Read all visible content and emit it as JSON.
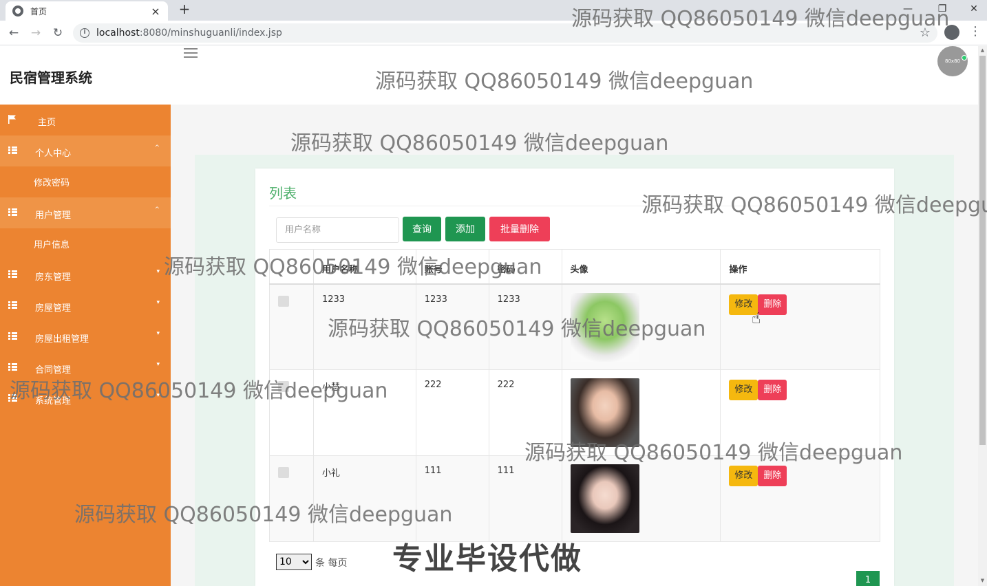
{
  "browser": {
    "tab_title": "首页",
    "tab_close": "×",
    "new_tab": "+",
    "url_host": "localhost",
    "url_rest": ":8080/minshuguanli/index.jsp",
    "win_min": "—",
    "win_max": "❐",
    "win_close": "✕"
  },
  "app": {
    "title": "民宿管理系统",
    "avatar_text": "80x80"
  },
  "sidebar": {
    "items": [
      {
        "label": "主页",
        "icon": "flag-icon"
      },
      {
        "label": "个人中心",
        "icon": "grid-icon",
        "expanded": true
      },
      {
        "label": "修改密码",
        "sub": true
      },
      {
        "label": "用户管理",
        "icon": "grid-icon",
        "expanded": true
      },
      {
        "label": "用户信息",
        "sub": true
      },
      {
        "label": "房东管理",
        "icon": "grid-icon"
      },
      {
        "label": "房屋管理",
        "icon": "grid-icon"
      },
      {
        "label": "房屋出租管理",
        "icon": "grid-icon"
      },
      {
        "label": "合同管理",
        "icon": "grid-icon"
      },
      {
        "label": "系统管理",
        "icon": "grid-icon"
      }
    ]
  },
  "main": {
    "card_title": "列表",
    "search_placeholder": "用户名称",
    "btn_query": "查询",
    "btn_add": "添加",
    "btn_batch_delete": "批量删除",
    "table": {
      "headers": [
        "",
        "用户名称",
        "账号",
        "密码",
        "头像",
        "操作"
      ],
      "rows": [
        {
          "name": "1233",
          "account": "1233",
          "password": "1233"
        },
        {
          "name": "小慧",
          "account": "222",
          "password": "222"
        },
        {
          "name": "小礼",
          "account": "111",
          "password": "111"
        }
      ],
      "edit_label": "修改",
      "delete_label": "删除"
    },
    "page_size": "10",
    "page_size_suffix": "条 每页",
    "current_page": "1"
  },
  "watermark": "源码获取 QQ86050149 微信deepguan",
  "promo_text": "专业毕设代做",
  "colors": {
    "sidebar": "#ec8431",
    "primary_green": "#1f9651",
    "danger": "#ee3f58",
    "warning": "#f5b80f"
  }
}
